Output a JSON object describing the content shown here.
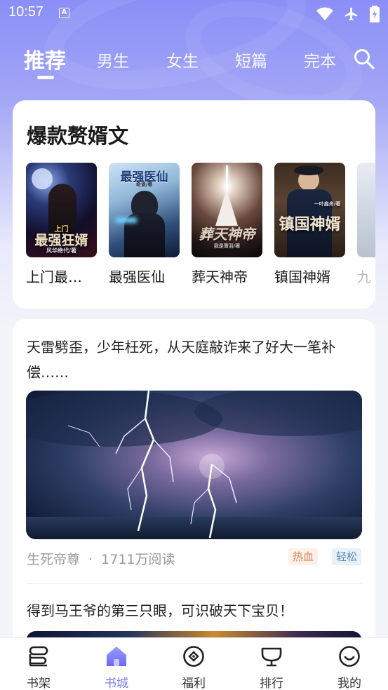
{
  "status_bar": {
    "time": "10:57",
    "notification_icon": "A"
  },
  "tabs": [
    {
      "label": "推荐",
      "active": true
    },
    {
      "label": "男生",
      "active": false
    },
    {
      "label": "女生",
      "active": false
    },
    {
      "label": "短篇",
      "active": false
    },
    {
      "label": "完本",
      "active": false
    }
  ],
  "hot_section": {
    "title": "爆款赘婿文",
    "books": [
      {
        "title": "上门最强狂婿",
        "display_title": "上门最…",
        "cover_text": "最强狂婿",
        "cover_sub": "上门",
        "cover_author": "风华绝代/著"
      },
      {
        "title": "最强医仙",
        "display_title": "最强医仙",
        "cover_text": "最强医仙",
        "cover_author": "奇谈/著"
      },
      {
        "title": "葬天神帝",
        "display_title": "葬天神帝",
        "cover_text": "葬天神帝",
        "cover_author": "我是萧羽/著"
      },
      {
        "title": "镇国神婿",
        "display_title": "镇国神婿",
        "cover_text": "镇国神婿",
        "cover_author": "一叶扁舟/著"
      },
      {
        "title": "",
        "display_title": "九",
        "cover_text": ""
      }
    ]
  },
  "feed": [
    {
      "description": "天雷劈歪，少年枉死，从天庭敲诈来了好大一笔补偿……",
      "book": "生死帝尊",
      "reads": "1711万阅读",
      "separator": "·",
      "tags": [
        "热血",
        "轻松"
      ]
    },
    {
      "description": "得到马王爷的第三只眼，可识破天下宝贝！"
    }
  ],
  "bottom_nav": [
    {
      "label": "书架",
      "icon": "bookshelf-icon",
      "active": false
    },
    {
      "label": "书城",
      "icon": "bookstore-home-icon",
      "active": true
    },
    {
      "label": "福利",
      "icon": "welfare-coin-icon",
      "active": false
    },
    {
      "label": "排行",
      "icon": "ranking-trophy-icon",
      "active": false
    },
    {
      "label": "我的",
      "icon": "profile-smile-icon",
      "active": false
    }
  ],
  "colors": {
    "accent": "#7b7cf6",
    "header_gradient_top": "#8a8ff7"
  }
}
